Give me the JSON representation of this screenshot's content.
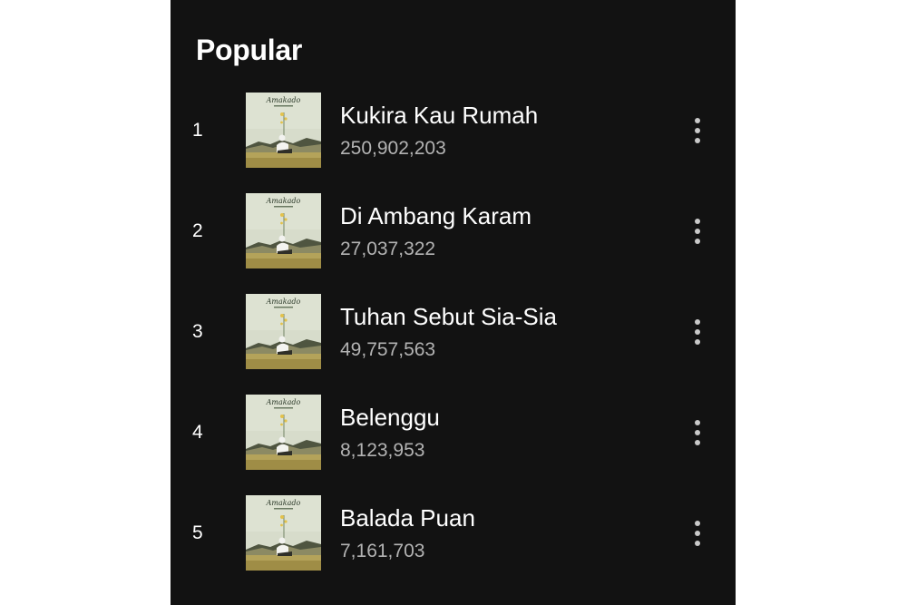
{
  "section": {
    "title": "Popular"
  },
  "tracks": [
    {
      "rank": "1",
      "title": "Kukira Kau Rumah",
      "plays": "250,902,203"
    },
    {
      "rank": "2",
      "title": "Di Ambang Karam",
      "plays": "27,037,322"
    },
    {
      "rank": "3",
      "title": "Tuhan Sebut Sia-Sia",
      "plays": "49,757,563"
    },
    {
      "rank": "4",
      "title": "Belenggu",
      "plays": "8,123,953"
    },
    {
      "rank": "5",
      "title": "Balada Puan",
      "plays": "7,161,703"
    }
  ],
  "icons": {
    "more": "more-vertical-icon",
    "album_art": "album-cover-image"
  },
  "colors": {
    "background": "#121212",
    "text": "#ffffff",
    "secondary_text": "#b3b3b3"
  }
}
